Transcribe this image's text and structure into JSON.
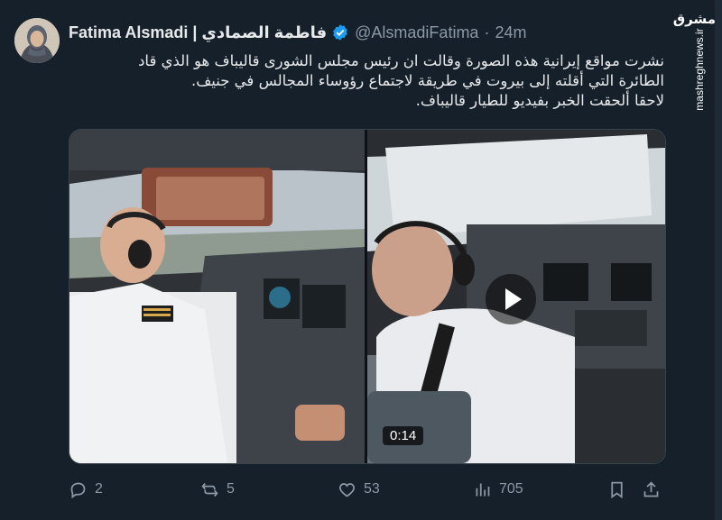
{
  "tweet": {
    "author_name": "Fatima Alsmadi | فاطمة الصمادي",
    "handle": "@AlsmadiFatima",
    "separator": "·",
    "time": "24m",
    "text_line1": "نشرت مواقع إيرانية هذه الصورة وقالت ان رئيس مجلس الشورى قاليباف هو الذي قاد",
    "text_line2": "الطائرة التي أقلته إلى بيروت في طريقة لاجتماع رؤوساء المجالس في جنيف.",
    "text_line3": "لاحقا ألحقت الخبر بفيديو للطيار قاليباف.",
    "video_duration": "0:14"
  },
  "actions": {
    "replies": "2",
    "reposts": "5",
    "likes": "53",
    "views": "705"
  },
  "watermark": {
    "logo": "مشرق",
    "site": "mashreghnews.ir"
  },
  "colors": {
    "background": "#15202b",
    "accent": "#1d9bf0",
    "muted": "#8b98a5"
  },
  "icons": [
    "verified-badge-icon",
    "reply-icon",
    "repost-icon",
    "like-icon",
    "views-icon",
    "bookmark-icon",
    "share-icon",
    "play-icon"
  ]
}
